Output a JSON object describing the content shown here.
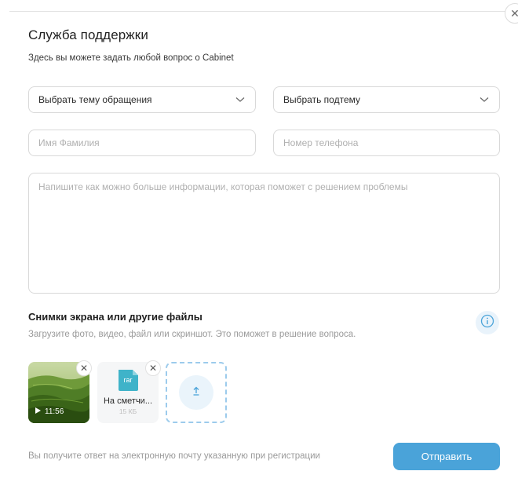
{
  "dialog": {
    "title": "Служба поддержки",
    "subtitle": "Здесь вы можете задать любой вопрос о Cabinet",
    "close_icon": "close-icon"
  },
  "form": {
    "topic_select": {
      "value": "Выбрать тему обращения"
    },
    "subtopic_select": {
      "value": "Выбрать подтему"
    },
    "name_input": {
      "value": "",
      "placeholder": "Имя Фамилия"
    },
    "phone_input": {
      "value": "",
      "placeholder": "Номер телефона"
    },
    "message_textarea": {
      "value": "",
      "placeholder": "Напишите как можно больше информации, которая поможет с решением проблемы"
    }
  },
  "attachments": {
    "title": "Снимки экрана или другие файлы",
    "hint": "Загрузите фото, видео, файл или скриншот. Это поможет в решение вопроса.",
    "info_icon": "info-icon",
    "video": {
      "duration": "11:56",
      "icon": "play-icon"
    },
    "file": {
      "ext": "rar",
      "name": "На сметчи...",
      "size": "15 КБ"
    },
    "upload_icon": "upload-arrow-icon"
  },
  "footer": {
    "note": "Вы получите ответ на электронную почту указанную при регистрации",
    "submit_label": "Отправить"
  },
  "colors": {
    "accent": "#4aa3d9",
    "upload_border": "#9ccbec",
    "file_icon": "#3fb3c9"
  }
}
